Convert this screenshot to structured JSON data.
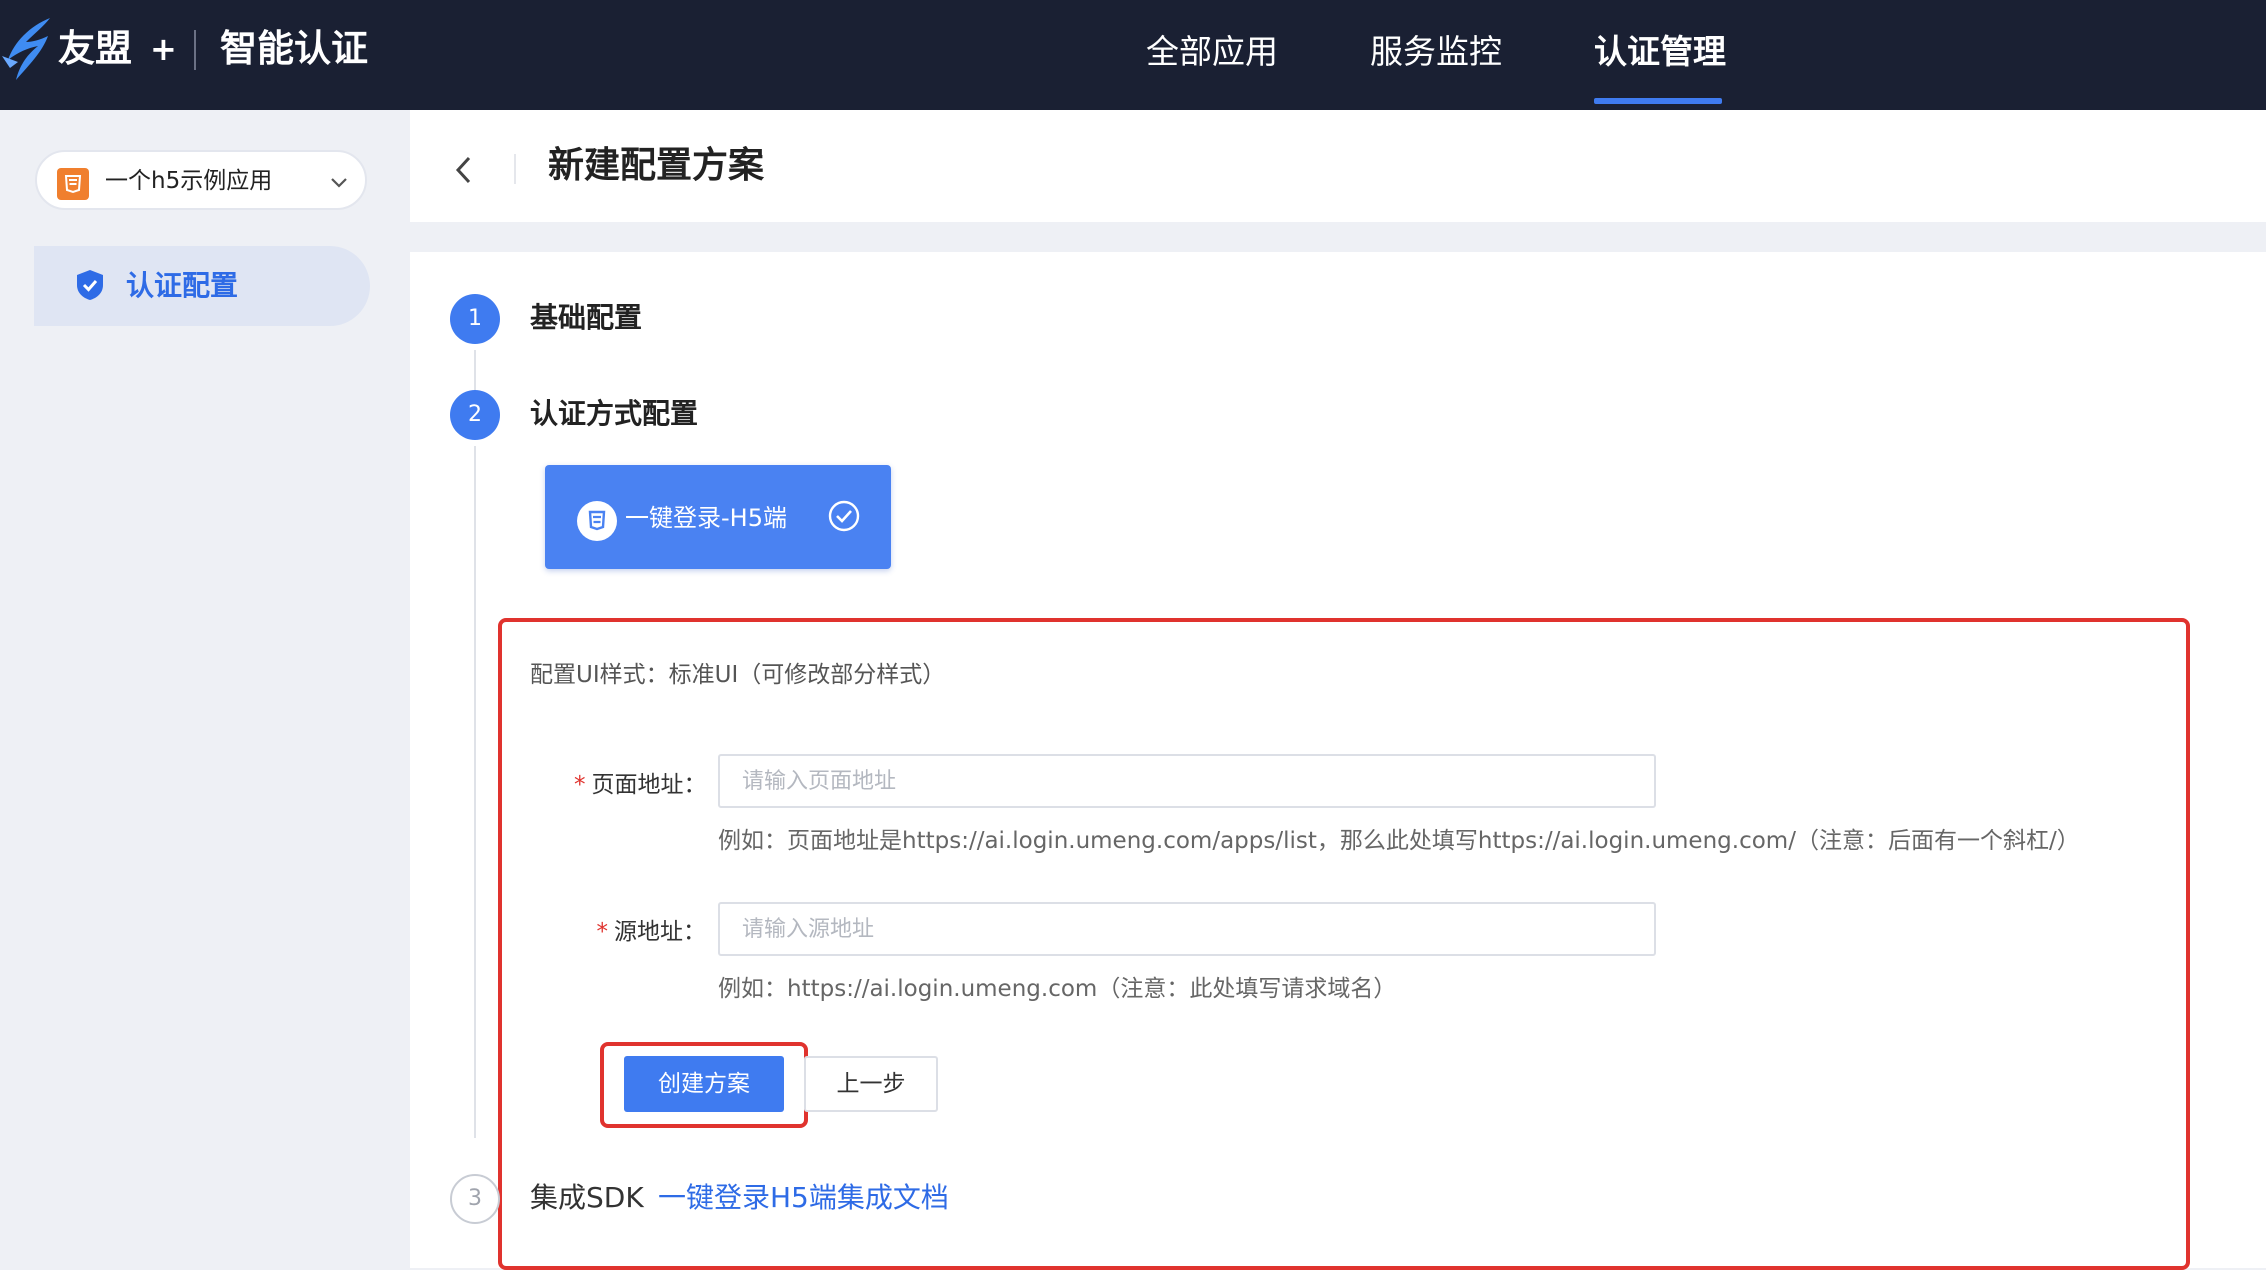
{
  "topbar": {
    "brand": "友盟",
    "brand_plus": "+",
    "product": "智能认证",
    "nav": [
      {
        "label": "全部应用",
        "active": false
      },
      {
        "label": "服务监控",
        "active": false
      },
      {
        "label": "认证管理",
        "active": true
      }
    ]
  },
  "sidebar": {
    "app_selector": {
      "value": "一个h5示例应用",
      "icon": "html5-icon"
    },
    "items": [
      {
        "label": "认证配置",
        "icon": "shield-check-icon",
        "active": true
      }
    ]
  },
  "header": {
    "title": "新建配置方案",
    "back_icon": "chevron-left-icon"
  },
  "steps": [
    {
      "number": "1",
      "title": "基础配置",
      "status": "done"
    },
    {
      "number": "2",
      "title": "认证方式配置",
      "status": "active"
    },
    {
      "number": "3",
      "title": "集成SDK",
      "status": "todo",
      "link": "一键登录H5端集成文档"
    }
  ],
  "method": {
    "label": "一键登录-H5端",
    "selected": true
  },
  "config": {
    "ui_style": "配置UI样式：标准UI（可修改部分样式）",
    "page_url": {
      "label": "页面地址：",
      "required_mark": "*",
      "placeholder": "请输入页面地址",
      "value": "",
      "hint": "例如：页面地址是https://ai.login.umeng.com/apps/list，那么此处填写https://ai.login.umeng.com/（注意：后面有一个斜杠/）"
    },
    "source_url": {
      "label": "源地址：",
      "required_mark": "*",
      "placeholder": "请输入源地址",
      "value": "",
      "hint": "例如：https://ai.login.umeng.com（注意：此处填写请求域名）"
    }
  },
  "actions": {
    "create": "创建方案",
    "previous": "上一步"
  },
  "colors": {
    "topbar": "#1a2033",
    "accent": "#3f7bf0",
    "highlight_border": "#e0332e"
  }
}
